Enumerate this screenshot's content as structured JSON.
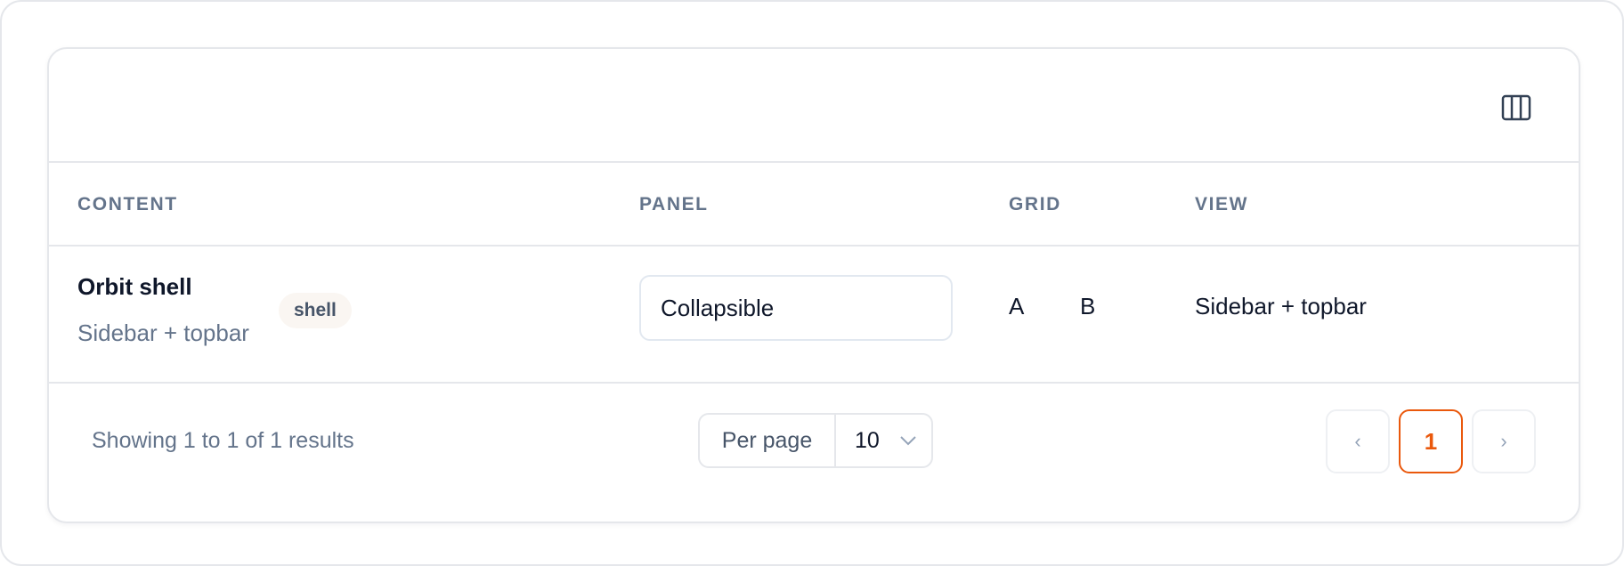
{
  "toolbar": {
    "columns_icon": "columns-icon"
  },
  "table": {
    "headers": {
      "content": "CONTENT",
      "panel": "PANEL",
      "grid": "GRID",
      "view": "VIEW"
    },
    "rows": [
      {
        "content_title": "Orbit shell",
        "content_subtitle": "Sidebar + topbar",
        "tag": "shell",
        "panel_value": "Collapsible",
        "grid_a": "A",
        "grid_b": "B",
        "view": "Sidebar + topbar"
      }
    ]
  },
  "footer": {
    "showing": "Showing 1 to 1 of 1 results",
    "per_page_label": "Per page",
    "per_page_value": "10",
    "prev": "‹",
    "current_page": "1",
    "next": "›"
  },
  "colors": {
    "accent": "#ea580c",
    "muted_text": "#64748b",
    "border": "#e5e7eb",
    "tag_bg": "#faf6f2"
  }
}
